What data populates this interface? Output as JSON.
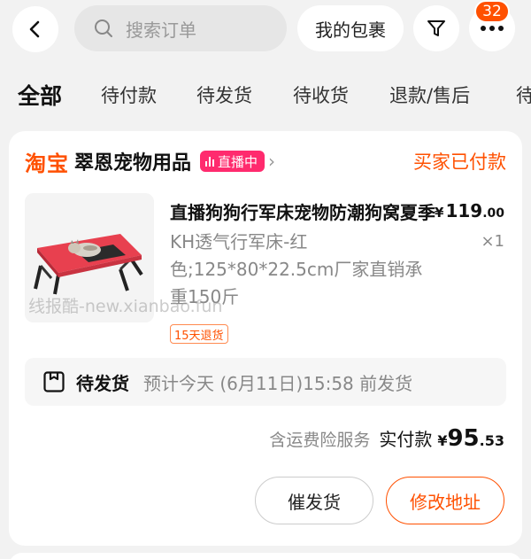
{
  "header": {
    "search_placeholder": "搜索订单",
    "packages_label": "我的包裹",
    "message_badge": "32",
    "icons": [
      "back-icon",
      "search-icon",
      "filter-icon",
      "more-icon"
    ]
  },
  "tabs": [
    {
      "label": "全部",
      "active": true
    },
    {
      "label": "待付款",
      "active": false
    },
    {
      "label": "待发货",
      "active": false
    },
    {
      "label": "待收货",
      "active": false
    },
    {
      "label": "退款/售后",
      "active": false
    },
    {
      "label": "待",
      "active": false
    }
  ],
  "order": {
    "platform_logo": "淘宝",
    "shop_name": "翠恩宠物用品",
    "live_label": "直播中",
    "status": "买家已付款",
    "product": {
      "title": "直播狗狗行军床宠物防潮狗窝夏季",
      "price_yen": "¥",
      "price_int": "119",
      "price_dec": ".00",
      "spec": "KH透气行军床-红色;125*80*22.5cm厂家直销承重150斤",
      "quantity": "×1",
      "return_tag": "15天退货"
    },
    "shipping": {
      "status": "待发货",
      "eta": "预计今天 (6月11日)15:58 前发货"
    },
    "payment": {
      "insurance": "含运费险服务",
      "label": "实付款",
      "yen": "¥",
      "amount_int": "95",
      "amount_dec": ".53"
    },
    "actions": {
      "urge_label": "催发货",
      "address_label": "修改地址"
    }
  },
  "watermark": "线报酷-new.xianbao.fun",
  "colors": {
    "accent": "#ff5000",
    "live": "#ff2b6e",
    "background": "#f2f2f2"
  }
}
